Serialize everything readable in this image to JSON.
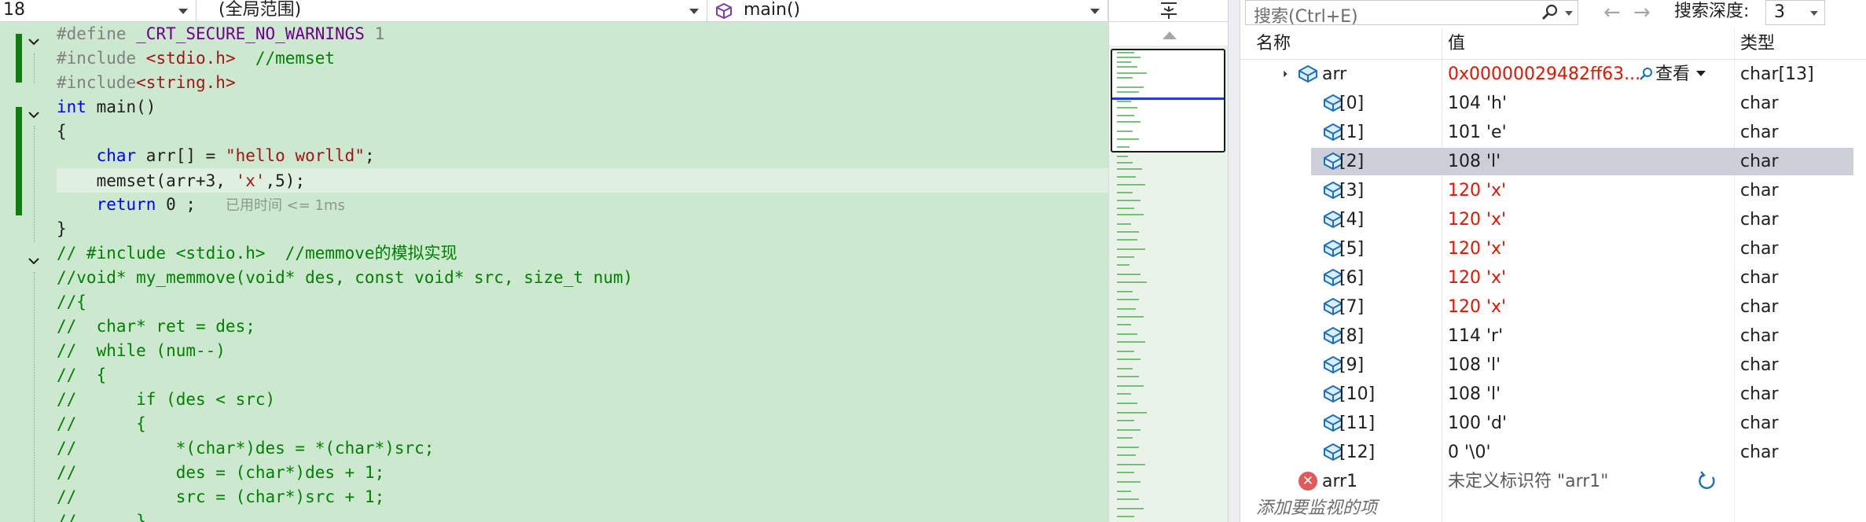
{
  "navbar": {
    "line_field": "18",
    "scope_dropdown": "(全局范围)",
    "function_dropdown": "main()"
  },
  "editor": {
    "lines": [
      {
        "tokens": [
          [
            "p",
            "#define "
          ],
          [
            "m",
            "_CRT_SECURE_NO_WARNINGS"
          ],
          [
            "p",
            " 1"
          ]
        ]
      },
      {
        "tokens": [
          [
            "p",
            "#include "
          ],
          [
            "s",
            "<stdio.h>"
          ],
          [
            "c",
            "  //memset"
          ]
        ]
      },
      {
        "tokens": [
          [
            "p",
            "#include"
          ],
          [
            "s",
            "<string.h>"
          ]
        ]
      },
      {
        "tokens": [
          [
            "k",
            "int"
          ],
          [
            "t",
            " main()"
          ]
        ]
      },
      {
        "tokens": [
          [
            "t",
            "{"
          ]
        ]
      },
      {
        "tokens": [
          [
            "t",
            "    "
          ],
          [
            "k",
            "char"
          ],
          [
            "t",
            " arr[] = "
          ],
          [
            "s",
            "\"hello worlld\""
          ],
          [
            "t",
            ";"
          ]
        ]
      },
      {
        "tokens": [
          [
            "t",
            "    memset(arr+3, "
          ],
          [
            "s",
            "'x'"
          ],
          [
            "t",
            ",5);"
          ]
        ],
        "current": true
      },
      {
        "tokens": [
          [
            "t",
            "    "
          ],
          [
            "k",
            "return"
          ],
          [
            "t",
            " 0 ;   "
          ],
          [
            "h",
            "已用时间 <= 1ms"
          ]
        ]
      },
      {
        "tokens": [
          [
            "t",
            "}"
          ]
        ]
      },
      {
        "tokens": [
          [
            "c",
            "// #include <stdio.h>  //memmove的模拟实现"
          ]
        ]
      },
      {
        "tokens": [
          [
            "c",
            "//void* my_memmove(void* des, const void* src, size_t num)"
          ]
        ]
      },
      {
        "tokens": [
          [
            "c",
            "//{"
          ]
        ]
      },
      {
        "tokens": [
          [
            "c",
            "//  char* ret = des;"
          ]
        ]
      },
      {
        "tokens": [
          [
            "c",
            "//  while (num--)"
          ]
        ]
      },
      {
        "tokens": [
          [
            "c",
            "//  {"
          ]
        ]
      },
      {
        "tokens": [
          [
            "c",
            "//      if (des < src)"
          ]
        ]
      },
      {
        "tokens": [
          [
            "c",
            "//      {"
          ]
        ]
      },
      {
        "tokens": [
          [
            "c",
            "//          *(char*)des = *(char*)src;"
          ]
        ]
      },
      {
        "tokens": [
          [
            "c",
            "//          des = (char*)des + 1;"
          ]
        ]
      },
      {
        "tokens": [
          [
            "c",
            "//          src = (char*)src + 1;"
          ]
        ]
      },
      {
        "tokens": [
          [
            "c",
            "//      }"
          ]
        ]
      }
    ]
  },
  "watch": {
    "search_placeholder": "搜索(Ctrl+E)",
    "back_arrow": "←",
    "forward_arrow": "→",
    "depth_label": "搜索深度:",
    "depth_value": "3",
    "columns": {
      "name": "名称",
      "value": "值",
      "type": "类型"
    },
    "root": {
      "name": "arr",
      "value": "0x00000029482ff63...",
      "view_label": "查看",
      "type": "char[13]"
    },
    "elements": [
      {
        "name": "[0]",
        "value": "104 'h'",
        "type": "char",
        "changed": false,
        "selected": false
      },
      {
        "name": "[1]",
        "value": "101 'e'",
        "type": "char",
        "changed": false,
        "selected": false
      },
      {
        "name": "[2]",
        "value": "108 'l'",
        "type": "char",
        "changed": false,
        "selected": true
      },
      {
        "name": "[3]",
        "value": "120 'x'",
        "type": "char",
        "changed": true,
        "selected": false
      },
      {
        "name": "[4]",
        "value": "120 'x'",
        "type": "char",
        "changed": true,
        "selected": false
      },
      {
        "name": "[5]",
        "value": "120 'x'",
        "type": "char",
        "changed": true,
        "selected": false
      },
      {
        "name": "[6]",
        "value": "120 'x'",
        "type": "char",
        "changed": true,
        "selected": false
      },
      {
        "name": "[7]",
        "value": "120 'x'",
        "type": "char",
        "changed": true,
        "selected": false
      },
      {
        "name": "[8]",
        "value": "114 'r'",
        "type": "char",
        "changed": false,
        "selected": false
      },
      {
        "name": "[9]",
        "value": "108 'l'",
        "type": "char",
        "changed": false,
        "selected": false
      },
      {
        "name": "[10]",
        "value": "108 'l'",
        "type": "char",
        "changed": false,
        "selected": false
      },
      {
        "name": "[11]",
        "value": "100 'd'",
        "type": "char",
        "changed": false,
        "selected": false
      },
      {
        "name": "[12]",
        "value": "0 '\\0'",
        "type": "char",
        "changed": false,
        "selected": false
      }
    ],
    "error_row": {
      "name": "arr1",
      "value": "未定义标识符 \"arr1\"",
      "icon_glyph": "✕"
    },
    "add_watch_label": "添加要监视的项"
  },
  "colors": {
    "editor_bg": "#cce8cf",
    "changed_value": "#e51400",
    "selection": "#ccced8",
    "comment": "#008000",
    "keyword": "#0000ff",
    "string": "#a31515"
  },
  "icons": {
    "object": "variable-object-icon",
    "error": "error-icon",
    "refresh": "refresh-icon",
    "search": "search-icon",
    "function": "function-cube-icon"
  }
}
